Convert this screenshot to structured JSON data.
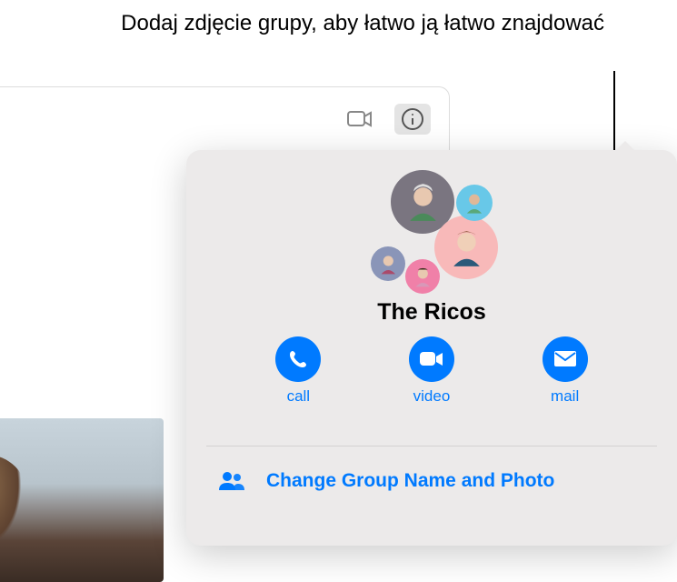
{
  "annotation": "Dodaj zdjęcie grupy, aby łatwo ją łatwo znajdować",
  "toolbar": {
    "video": "video-icon",
    "info": "info-icon"
  },
  "group": {
    "name": "The Ricos"
  },
  "actions": {
    "call": {
      "label": "call"
    },
    "video": {
      "label": "video"
    },
    "mail": {
      "label": "mail"
    }
  },
  "change_row": {
    "label": "Change Group Name and Photo"
  }
}
